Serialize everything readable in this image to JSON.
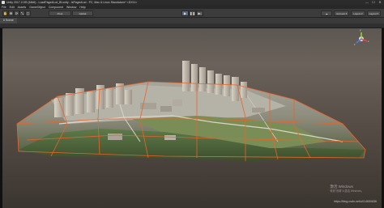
{
  "window": {
    "title": "Unity 2017.2.0f3 (64bit) - LoadPagedLod_Bl.unity - IsPagedLod - PC, Mac & Linux Standalone* <DX11>",
    "controls": [
      "—",
      "☐",
      "✕"
    ]
  },
  "menubar": {
    "items": [
      "File",
      "Edit",
      "Assets",
      "GameObject",
      "Component",
      "Window",
      "Help"
    ]
  },
  "toolbar": {
    "pivot_label": "Pivot",
    "global_label": "Global",
    "tools": [
      "✋",
      "✥",
      "⟳",
      "⤡",
      "▢"
    ],
    "play": [
      "▶",
      "❚❚",
      "▶|"
    ],
    "right": [
      "☁",
      "Account ▾",
      "Layers ▾",
      "Layout ▾"
    ]
  },
  "scene": {
    "tab_label": "# Scene"
  },
  "gizmo": {
    "y_label": "y",
    "x_label": "x",
    "z_label": "z"
  },
  "watermark": {
    "line1": "激活 Windows",
    "line2": "转到\"设置\"以激活 Windows。"
  },
  "csdn": {
    "url": "https://blog.csdn.net/u014650836"
  },
  "colors": {
    "accent_orange": "#e8652a",
    "sky": "#5d5751"
  }
}
